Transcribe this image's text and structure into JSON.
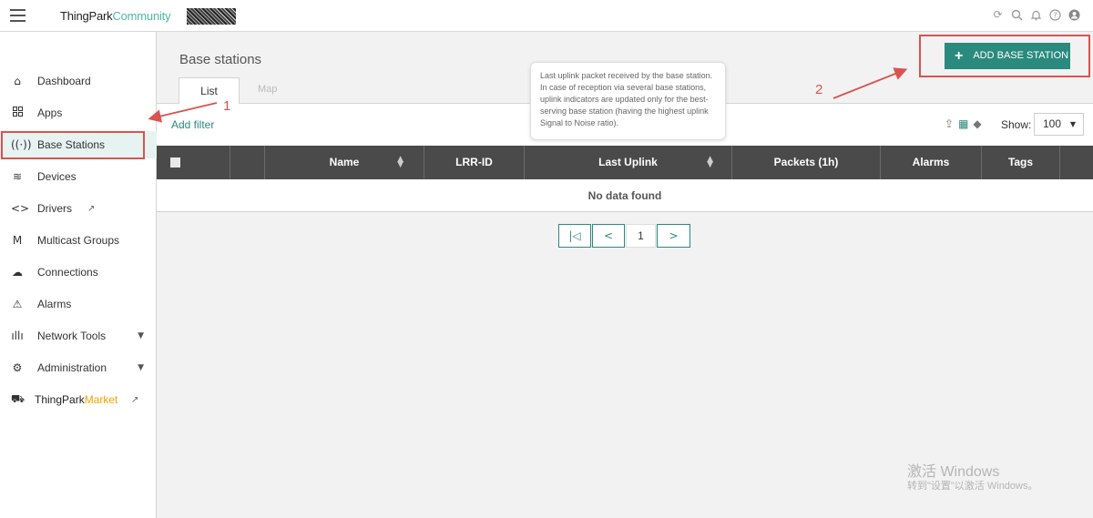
{
  "header": {
    "brand_primary": "ThingPark",
    "brand_secondary": "Community",
    "icons": [
      "refresh-icon",
      "search-icon",
      "bell-icon",
      "help-icon",
      "user-icon"
    ]
  },
  "sidebar": {
    "items": [
      {
        "label": "Dashboard",
        "icon": "home-icon"
      },
      {
        "label": "Apps",
        "icon": "grid-icon"
      },
      {
        "label": "Base Stations",
        "icon": "antenna-icon"
      },
      {
        "label": "Devices",
        "icon": "device-icon"
      },
      {
        "label": "Drivers",
        "icon": "code-icon"
      },
      {
        "label": "Multicast Groups",
        "icon": "multicast-icon"
      },
      {
        "label": "Connections",
        "icon": "cloud-icon"
      },
      {
        "label": "Alarms",
        "icon": "warning-icon"
      },
      {
        "label": "Network Tools",
        "icon": "waveform-icon"
      },
      {
        "label": "Administration",
        "icon": "gear-icon"
      }
    ],
    "market_primary": "ThingPark",
    "market_secondary": "Market"
  },
  "main": {
    "title": "Base stations",
    "tabs": {
      "list": "List",
      "map": "Map"
    },
    "add_filter": "Add filter",
    "show_label": "Show:",
    "show_value": "100",
    "add_button": "ADD BASE STATION",
    "table": {
      "columns": [
        "Name",
        "LRR-ID",
        "Last Uplink",
        "Packets (1h)",
        "Alarms",
        "Tags"
      ],
      "empty_message": "No data found"
    },
    "pagination": {
      "current_page": "1"
    },
    "tooltip": "Last uplink packet received by the base station. In case of reception via several base stations, uplink indicators are updated only for the best-serving base station (having the highest uplink Signal to Noise ratio)."
  },
  "annotations": {
    "label1": "1",
    "label2": "2"
  },
  "watermark": {
    "line1": "激活 Windows",
    "line2": "转到\"设置\"以激活 Windows。"
  },
  "colors": {
    "accent": "#2a8a7e",
    "annotation": "#d9534f",
    "header_dark": "#4a4a4a"
  }
}
